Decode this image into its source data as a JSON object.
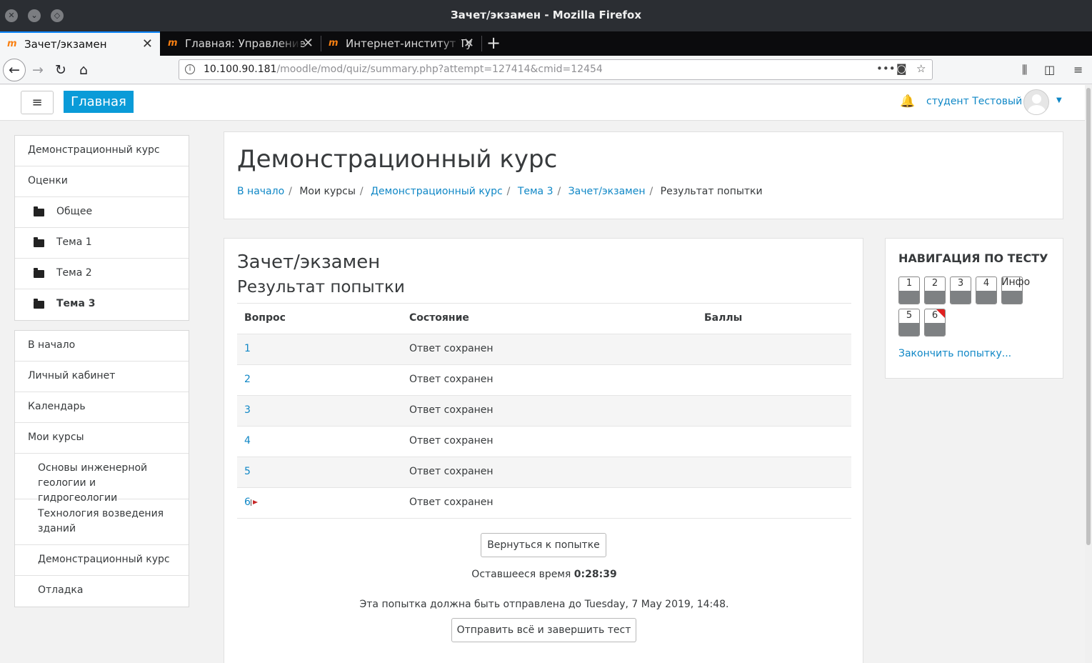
{
  "window": {
    "title": "Зачет/экзамен - Mozilla Firefox"
  },
  "tabs": [
    {
      "label": "Зачет/экзамен",
      "active": true
    },
    {
      "label": "Главная: Управление",
      "active": false
    },
    {
      "label": "Интернет-институт Ту",
      "active": false
    }
  ],
  "address": {
    "host": "10.100.90.181",
    "path": "/moodle/mod/quiz/summary.php?attempt=127414&cmid=12454"
  },
  "header": {
    "home_label": "Главная",
    "user_name": "студент Тестовый"
  },
  "sidebar": {
    "course_nav": [
      {
        "label": "Демонстрационный курс"
      },
      {
        "label": "Оценки"
      },
      {
        "label": "Общее"
      },
      {
        "label": "Тема 1"
      },
      {
        "label": "Тема 2"
      },
      {
        "label": "Тема 3"
      }
    ],
    "site_nav": [
      {
        "label": "В начало"
      },
      {
        "label": "Личный кабинет"
      },
      {
        "label": "Календарь"
      },
      {
        "label": "Мои курсы"
      },
      {
        "label": "Основы инженерной геологии и гидрогеологии"
      },
      {
        "label": "Технология возведения зданий"
      },
      {
        "label": "Демонстрационный курс"
      },
      {
        "label": "Отладка"
      }
    ]
  },
  "page": {
    "course_title": "Демонстрационный курс",
    "breadcrumb": [
      "В начало",
      "Мои курсы",
      "Демонстрационный курс",
      "Тема 3",
      "Зачет/экзамен",
      "Результат попытки"
    ]
  },
  "quiz": {
    "title": "Зачет/экзамен",
    "subtitle": "Результат попытки",
    "columns": [
      "Вопрос",
      "Состояние",
      "Баллы"
    ],
    "rows": [
      {
        "q": "1",
        "state": "Ответ сохранен",
        "score": ""
      },
      {
        "q": "2",
        "state": "Ответ сохранен",
        "score": ""
      },
      {
        "q": "3",
        "state": "Ответ сохранен",
        "score": ""
      },
      {
        "q": "4",
        "state": "Ответ сохранен",
        "score": ""
      },
      {
        "q": "5",
        "state": "Ответ сохранен",
        "score": ""
      },
      {
        "q": "6",
        "state": "Ответ сохранен",
        "score": "",
        "flagged": true
      }
    ],
    "return_button": "Вернуться к попытке",
    "time_left_label": "Оставшееся время",
    "time_left": "0:28:39",
    "deadline_text": "Эта попытка должна быть отправлена до Tuesday, 7 May 2019, 14:48.",
    "submit_button": "Отправить всё и завершить тест"
  },
  "quiz_nav": {
    "title": "НАВИГАЦИЯ ПО ТЕСТУ",
    "buttons": [
      "1",
      "2",
      "3",
      "4",
      "Инфо",
      "5",
      "6"
    ],
    "finish_link": "Закончить попытку..."
  },
  "colors": {
    "link": "#0f87c6",
    "home_button": "#0a9bd8",
    "flag": "#e02020"
  }
}
